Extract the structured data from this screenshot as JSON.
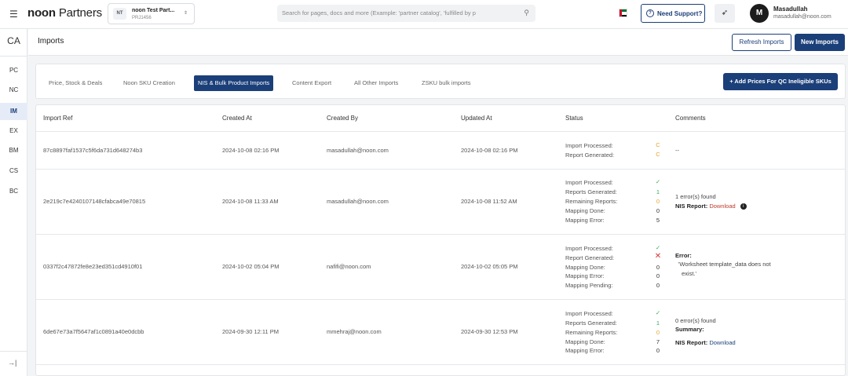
{
  "topbar": {
    "menu_icon": "hamburger-icon",
    "logo_brand": "noon",
    "logo_suffix": "Partners",
    "project": {
      "badge": "NT",
      "name": "noon Test Part...",
      "id": "PRJ1456"
    },
    "search_placeholder": "Search for pages, docs and more (Example: 'partner catalog', 'fulfilled by p",
    "support_label": "Need Support?",
    "user": {
      "initial": "M",
      "name": "Masadullah",
      "email": "masadullah@noon.com"
    },
    "flag_colors": [
      "#c8102e",
      "#00732f",
      "#ffffff",
      "#000000"
    ]
  },
  "sidebar": {
    "top": "CA",
    "items": [
      "PC",
      "NC",
      "IM",
      "EX",
      "BM",
      "CS",
      "BC"
    ],
    "active": "IM",
    "collapse_icon": "collapse-arrow-icon"
  },
  "header": {
    "title": "Imports",
    "refresh_label": "Refresh Imports",
    "new_label": "New Imports"
  },
  "tabs": {
    "items": [
      "Price, Stock & Deals",
      "Noon SKU Creation",
      "NIS & Bulk Product Imports",
      "Content Export",
      "All Other Imports",
      "ZSKU bulk imports"
    ],
    "active": "NIS & Bulk Product Imports",
    "add_button": "+ Add Prices For QC Ineligible SKUs"
  },
  "table": {
    "columns": [
      "Import Ref",
      "Created At",
      "Created By",
      "Updated At",
      "Status",
      "Comments"
    ],
    "rows": [
      {
        "ref": "87c8897faf1537c5f6da731d648274b3",
        "created_at": "2024-10-08 02:16 PM",
        "created_by": "masadullah@noon.com",
        "updated_at": "2024-10-08 02:16 PM",
        "status": [
          {
            "label": "Import Processed:",
            "value": "C"
          },
          {
            "label": "Report Generated:",
            "value": "C"
          }
        ],
        "comment_lines": [
          "--"
        ]
      },
      {
        "ref": "2e219c7e4240107148cfabca49e70815",
        "created_at": "2024-10-08 11:33 AM",
        "created_by": "masadullah@noon.com",
        "updated_at": "2024-10-08 11:52 AM",
        "status": [
          {
            "label": "Import Processed:",
            "value": "✓"
          },
          {
            "label": "Reports Generated:",
            "value": "1"
          },
          {
            "label": "Remaining Reports:",
            "value": "0"
          },
          {
            "label": "Mapping Done:",
            "value": "0"
          },
          {
            "label": "Mapping Error:",
            "value": "5"
          }
        ],
        "comment_lines": [
          "1 error(s) found"
        ],
        "nis_label": "NIS Report:",
        "nis_link": "Download"
      },
      {
        "ref": "0337f2c47872fe8e23ed351cd4910f01",
        "created_at": "2024-10-02 05:04 PM",
        "created_by": "nafifi@noon.com",
        "updated_at": "2024-10-02 05:05 PM",
        "status": [
          {
            "label": "Import Processed:",
            "value": "✓"
          },
          {
            "label": "Report Generated:",
            "value": "✕"
          },
          {
            "label": "Mapping Done:",
            "value": "0"
          },
          {
            "label": "Mapping Error:",
            "value": "0"
          },
          {
            "label": "Mapping Pending:",
            "value": "0"
          }
        ],
        "comment_title": "Error:",
        "comment_lines": [
          "'Worksheet template_data does not",
          "exist.'"
        ]
      },
      {
        "ref": "6de67e73a7f5647af1c0891a40e0dcbb",
        "created_at": "2024-09-30 12:11 PM",
        "created_by": "mmehraj@noon.com",
        "updated_at": "2024-09-30 12:53 PM",
        "status": [
          {
            "label": "Import Processed:",
            "value": "✓"
          },
          {
            "label": "Reports Generated:",
            "value": "1"
          },
          {
            "label": "Remaining Reports:",
            "value": "0"
          },
          {
            "label": "Mapping Done:",
            "value": "7"
          },
          {
            "label": "Mapping Error:",
            "value": "0"
          }
        ],
        "comment_lines": [
          "0 error(s) found"
        ],
        "summary_label": "Summary:",
        "nis_label": "NIS Report:",
        "nis_link": "Download"
      }
    ]
  }
}
